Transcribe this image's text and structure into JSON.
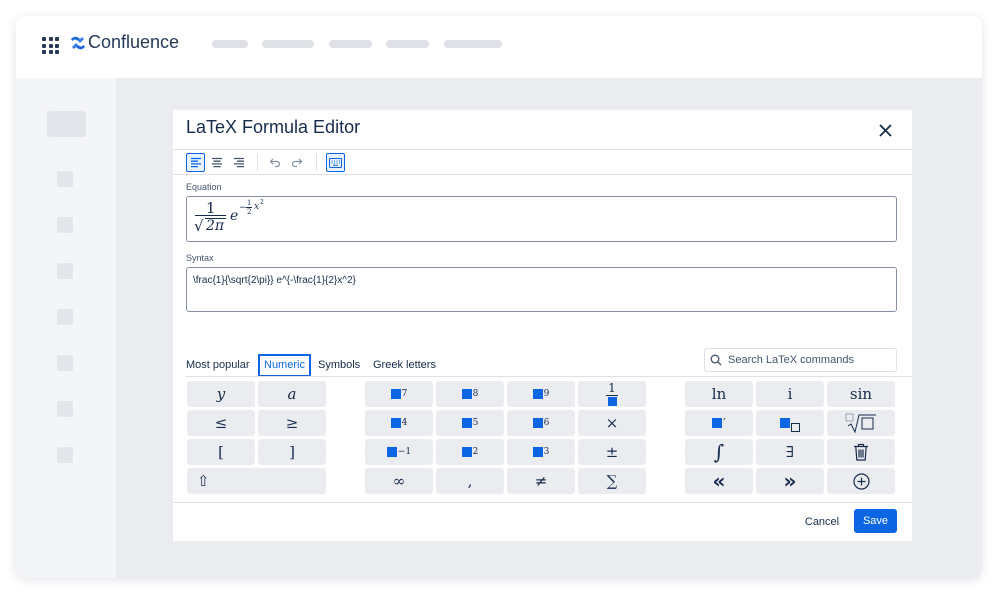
{
  "header": {
    "app_name": "Confluence"
  },
  "dialog": {
    "title": "LaTeX Formula Editor",
    "equation_label": "Equation",
    "syntax_label": "Syntax",
    "syntax_value": "\\frac{1}{\\sqrt{2\\pi}} e^{-\\frac{1}{2}x^2}",
    "equation_render": {
      "numerator": "1",
      "sqrt_arg": "2π",
      "base": "e",
      "exp_minus": "−",
      "exp_num": "1",
      "exp_den": "2",
      "exp_var": "x",
      "exp_pow": "2"
    },
    "tabs": [
      "Most popular",
      "Numeric",
      "Symbols",
      "Greek letters"
    ],
    "active_tab": "Numeric",
    "search_placeholder": "Search LaTeX commands",
    "cancel_label": "Cancel",
    "save_label": "Save"
  },
  "keys": {
    "y": "y",
    "a": "a",
    "le": "≤",
    "ge": "≥",
    "lbracket": "[",
    "rbracket": "]",
    "shift": "⇧",
    "p7": "7",
    "p8": "8",
    "p9": "9",
    "frac_num": "1",
    "p4": "4",
    "p5": "5",
    "p6": "6",
    "times": "×",
    "pm1": "−1",
    "p2": "2",
    "p3": "3",
    "pm": "±",
    "inf": "∞",
    "comma": ",",
    "neq": "≠",
    "sum": "∑",
    "ln": "ln",
    "i": "i",
    "sin": "sin",
    "prime": "′",
    "integral": "∫",
    "exists": "∃",
    "left": "«",
    "right": "»"
  },
  "colors": {
    "accent": "#0c66e4",
    "text": "#172b4d",
    "key_bg": "#ebecf0"
  }
}
